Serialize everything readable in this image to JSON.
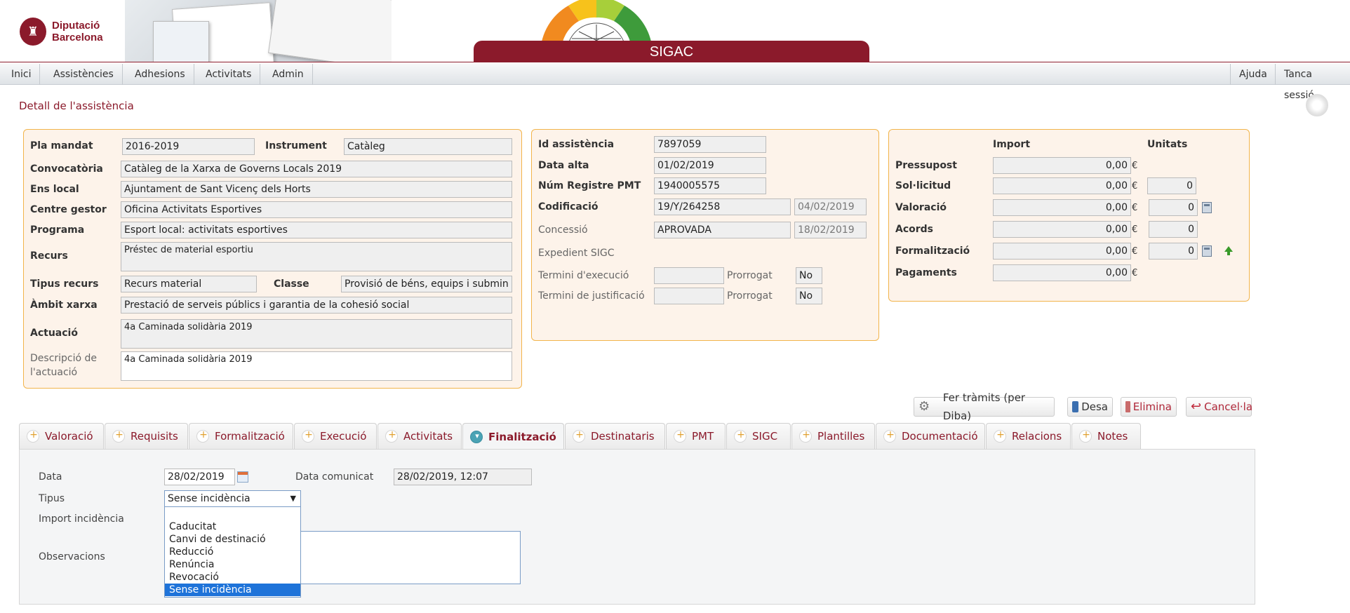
{
  "header": {
    "logo_line1": "Diputació",
    "logo_line2": "Barcelona",
    "app_title": "SIGAC",
    "brand_color": "#8b1a2b"
  },
  "nav": {
    "left": [
      "Inici",
      "Assistències",
      "Adhesions",
      "Activitats",
      "Admin"
    ],
    "right": [
      "Ajuda",
      "Tanca sessió"
    ]
  },
  "page": {
    "title": "Detall de l'assistència"
  },
  "panel1": {
    "pla_mandat_label": "Pla mandat",
    "pla_mandat": "2016-2019",
    "instrument_label": "Instrument",
    "instrument": "Catàleg",
    "convocatoria_label": "Convocatòria",
    "convocatoria": "Catàleg de la Xarxa de Governs Locals 2019",
    "ens_local_label": "Ens local",
    "ens_local": "Ajuntament de Sant Vicenç dels Horts",
    "centre_gestor_label": "Centre gestor",
    "centre_gestor": "Oficina Activitats Esportives",
    "programa_label": "Programa",
    "programa": "Esport local: activitats esportives",
    "recurs_label": "Recurs",
    "recurs": "Préstec de material esportiu",
    "tipus_recurs_label": "Tipus recurs",
    "tipus_recurs": "Recurs material",
    "classe_label": "Classe",
    "classe": "Provisió de béns, equips i submin",
    "ambit_xarxa_label": "Àmbit xarxa",
    "ambit_xarxa": "Prestació de serveis públics i garantia de la cohesió social",
    "actuacio_label": "Actuació",
    "actuacio": "4a Caminada solidària 2019",
    "descripcio_label_1": "Descripció de",
    "descripcio_label_2": "l'actuació",
    "descripcio": "4a Caminada solidària 2019"
  },
  "panel2": {
    "id_label": "Id assistència",
    "id": "7897059",
    "data_alta_label": "Data alta",
    "data_alta": "01/02/2019",
    "num_registre_label": "Núm Registre PMT",
    "num_registre": "1940005575",
    "codificacio_label": "Codificació",
    "codificacio": "19/Y/264258",
    "codificacio_date": "04/02/2019",
    "concessio_label": "Concessió",
    "concessio": "APROVADA",
    "concessio_date": "18/02/2019",
    "expedient_label": "Expedient SIGC",
    "termini_exec_label": "Termini d'execució",
    "termini_exec": "",
    "prorrogat_label": "Prorrogat",
    "prorrogat_exec": "No",
    "termini_just_label": "Termini de justificació",
    "termini_just": "",
    "prorrogat_just": "No"
  },
  "panel3": {
    "import_header": "Import",
    "unitats_header": "Unitats",
    "currency": "€",
    "rows": [
      {
        "label": "Pressupost",
        "import": "0,00",
        "unitats": null
      },
      {
        "label": "Sol·licitud",
        "import": "0,00",
        "unitats": "0"
      },
      {
        "label": "Valoració",
        "import": "0,00",
        "unitats": "0"
      },
      {
        "label": "Acords",
        "import": "0,00",
        "unitats": "0"
      },
      {
        "label": "Formalització",
        "import": "0,00",
        "unitats": "0"
      },
      {
        "label": "Pagaments",
        "import": "0,00",
        "unitats": null
      }
    ]
  },
  "actions": {
    "fer_tramits": "Fer tràmits (per Diba)",
    "desa": "Desa",
    "elimina": "Elimina",
    "cancela": "Cancel·la"
  },
  "tabs": [
    "Valoració",
    "Requisits",
    "Formalització",
    "Execució",
    "Activitats",
    "Finalització",
    "Destinataris",
    "PMT",
    "SIGC",
    "Plantilles",
    "Documentació",
    "Relacions",
    "Notes"
  ],
  "active_tab": "Finalització",
  "finalitzacio": {
    "data_label": "Data",
    "data": "28/02/2019",
    "data_comunicat_label": "Data comunicat",
    "data_comunicat": "28/02/2019, 12:07",
    "tipus_label": "Tipus",
    "tipus_selected": "Sense incidència",
    "import_incidencia_label": "Import incidència",
    "observacions_label": "Observacions",
    "tipus_options": [
      "",
      "Caducitat",
      "Canvi de destinació",
      "Reducció",
      "Renúncia",
      "Revocació",
      "Sense incidència"
    ]
  }
}
